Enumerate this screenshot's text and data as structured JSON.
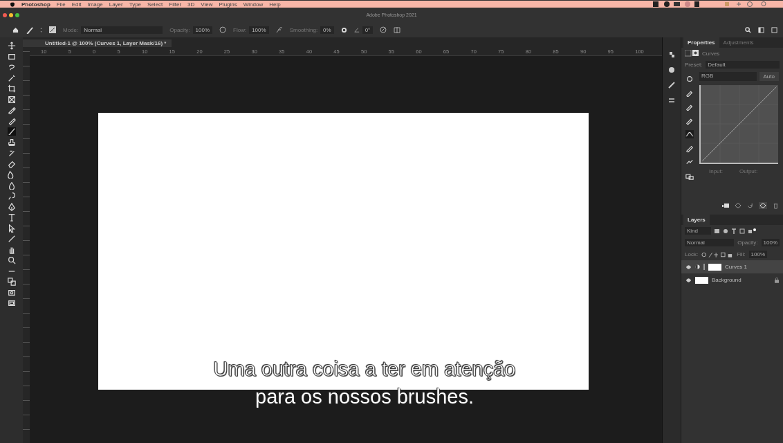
{
  "menu_bar": {
    "app": "Photoshop",
    "items": [
      "File",
      "Edit",
      "Image",
      "Layer",
      "Type",
      "Select",
      "Filter",
      "3D",
      "View",
      "Plugins",
      "Window",
      "Help"
    ]
  },
  "window": {
    "title": "Adobe Photoshop 2021"
  },
  "options_bar": {
    "mode_label": "Mode:",
    "mode": "Normal",
    "opacity_label": "Opacity:",
    "opacity": "100%",
    "flow_label": "Flow:",
    "flow": "100%",
    "smoothing_label": "Smoothing:",
    "smoothing": "0%",
    "angle": "0°"
  },
  "document_tab": {
    "title": "Untitled-1 @ 100% (Curves 1, Layer Mask/16) *"
  },
  "ruler": {
    "labels": [
      "10",
      "5",
      "0",
      "5",
      "10",
      "15",
      "20",
      "25",
      "30",
      "35",
      "40",
      "45",
      "50",
      "55",
      "60",
      "65",
      "70",
      "75",
      "80",
      "85",
      "90",
      "95",
      "100"
    ]
  },
  "tools": [
    {
      "kind": "move",
      "selected": false
    },
    {
      "kind": "marquee",
      "selected": false
    },
    {
      "kind": "lasso",
      "selected": false
    },
    {
      "kind": "wand",
      "selected": false
    },
    {
      "kind": "crop",
      "selected": false
    },
    {
      "kind": "frame",
      "selected": false
    },
    {
      "kind": "eyedropper",
      "selected": false
    },
    {
      "kind": "healing",
      "selected": false
    },
    {
      "kind": "brush",
      "selected": true
    },
    {
      "kind": "stamp",
      "selected": false
    },
    {
      "kind": "history",
      "selected": false
    },
    {
      "kind": "eraser",
      "selected": false
    },
    {
      "kind": "gradient",
      "selected": false
    },
    {
      "kind": "blur",
      "selected": false
    },
    {
      "kind": "dodge",
      "selected": false
    },
    {
      "kind": "pen",
      "selected": false
    },
    {
      "kind": "type",
      "selected": false
    },
    {
      "kind": "select",
      "selected": false
    },
    {
      "kind": "line",
      "selected": false
    },
    {
      "kind": "hand",
      "selected": false
    },
    {
      "kind": "zoom",
      "selected": false
    },
    {
      "kind": "more",
      "selected": false
    },
    {
      "kind": "swatches",
      "selected": false
    },
    {
      "kind": "mask",
      "selected": false
    },
    {
      "kind": "screen",
      "selected": false
    }
  ],
  "subtitle": {
    "lines": [
      "Uma outra coisa a ter em atenção",
      "para os nossos brushes."
    ]
  },
  "properties": {
    "tabs": [
      {
        "label": "Properties",
        "selected": true
      },
      {
        "label": "Adjustments",
        "selected": false
      }
    ],
    "adjustment": "Curves",
    "preset_label": "Preset:",
    "preset": "Default",
    "channel": "RGB",
    "auto_button": "Auto",
    "input_label": "Input:",
    "output_label": "Output:",
    "curve_tools": [
      {
        "kind": "target",
        "selected": false
      },
      {
        "kind": "dropper",
        "selected": false
      },
      {
        "kind": "dropper",
        "selected": false
      },
      {
        "kind": "dropper",
        "selected": false
      },
      {
        "kind": "curve",
        "selected": true
      },
      {
        "kind": "pencil",
        "selected": false
      },
      {
        "kind": "smooth",
        "selected": false
      },
      {
        "kind": "warning",
        "selected": false
      }
    ]
  },
  "layers": {
    "tabs": [
      {
        "label": "Layers",
        "selected": true
      }
    ],
    "filter": "Kind",
    "blend_mode": "Normal",
    "opacity_label": "Opacity:",
    "opacity": "100%",
    "lock_label": "Lock:",
    "fill_label": "Fill:",
    "fill": "100%",
    "items": [
      {
        "name": "Curves 1",
        "kind": "adjustment",
        "selected": true,
        "visible": true
      },
      {
        "name": "Background",
        "kind": "pixel",
        "selected": false,
        "visible": true
      }
    ]
  }
}
